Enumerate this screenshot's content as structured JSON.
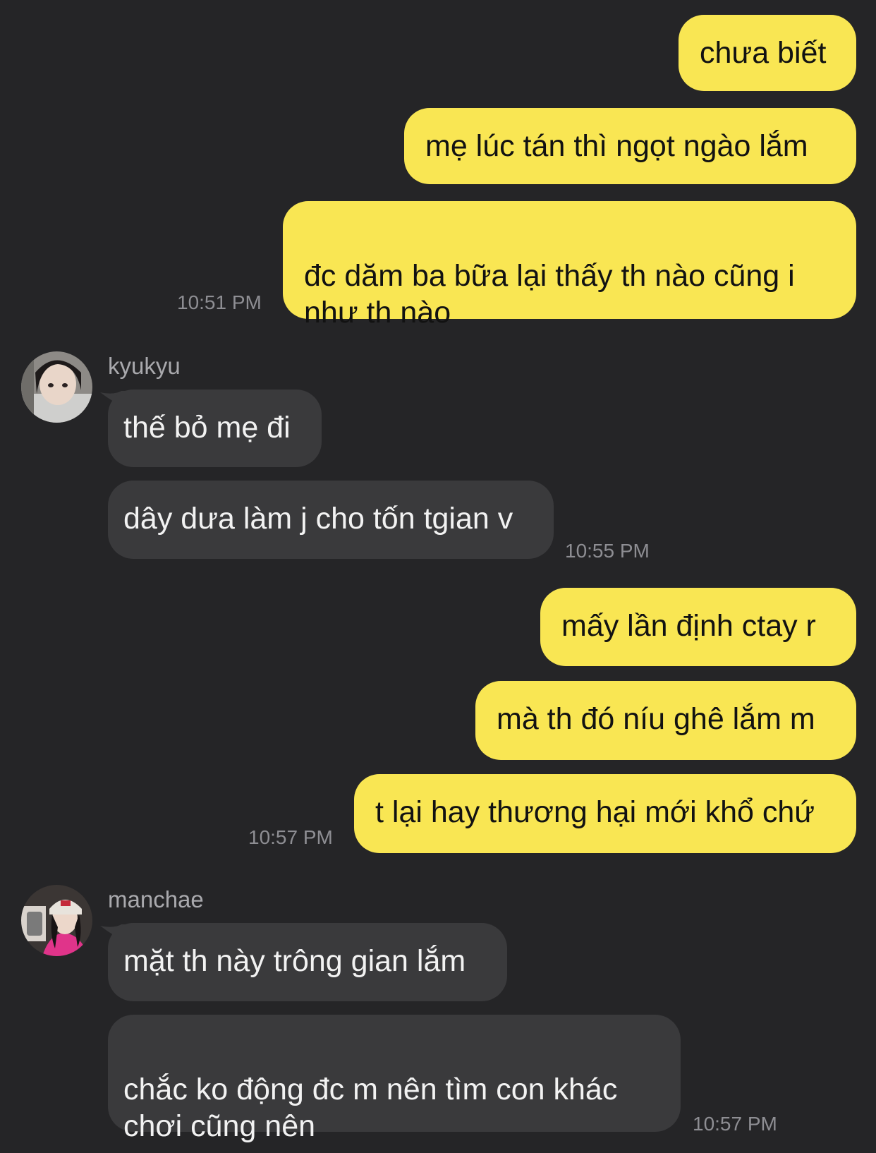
{
  "conversation": [
    {
      "type": "me",
      "text": "chưa biết"
    },
    {
      "type": "me",
      "text": "mẹ lúc tán thì ngọt ngào lắm"
    },
    {
      "type": "me",
      "text": "đc dăm ba bữa lại thấy th nào cũng i\nnhư th nào"
    },
    {
      "type": "time",
      "text": "10:51 PM"
    },
    {
      "type": "sender",
      "name": "kyukyu",
      "avatar": "avatar-photo"
    },
    {
      "type": "them",
      "text": "thế bỏ mẹ đi"
    },
    {
      "type": "them",
      "text": "dây dưa làm j cho tốn tgian v"
    },
    {
      "type": "time",
      "text": "10:55 PM"
    },
    {
      "type": "me",
      "text": "mấy lần định ctay r"
    },
    {
      "type": "me",
      "text": "mà th đó níu ghê lắm m"
    },
    {
      "type": "me",
      "text": "t lại hay thương hại mới khổ chứ"
    },
    {
      "type": "time",
      "text": "10:57 PM"
    },
    {
      "type": "sender",
      "name": "manchae",
      "avatar": "avatar-photo"
    },
    {
      "type": "them",
      "text": "mặt th này trông gian lắm"
    },
    {
      "type": "them",
      "text": "chắc ko động đc m nên tìm con khác\nchơi cũng nên"
    },
    {
      "type": "time",
      "text": "10:57 PM"
    }
  ],
  "colors": {
    "background": "#252527",
    "outgoing": "#f9e653",
    "incoming": "#3a3a3c"
  }
}
